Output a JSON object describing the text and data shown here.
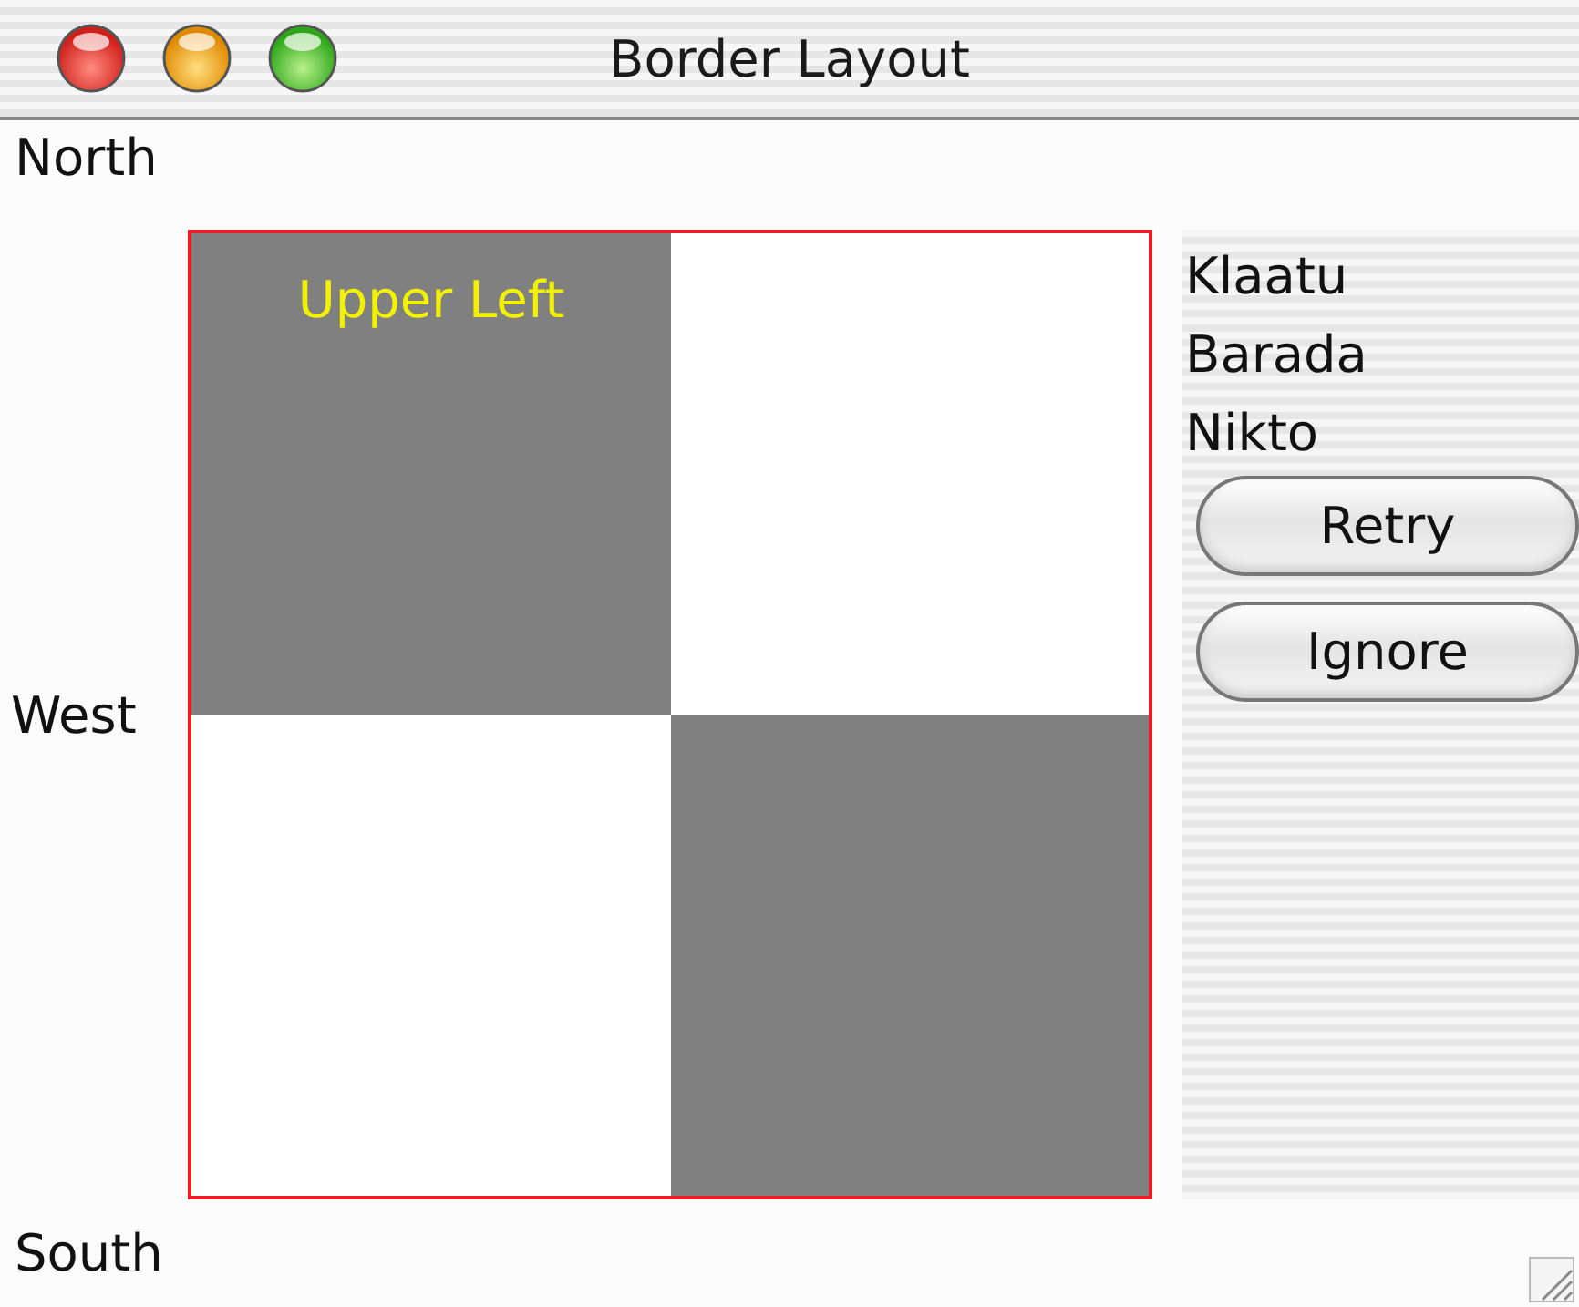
{
  "window": {
    "title": "Border Layout"
  },
  "north": {
    "label": "North"
  },
  "west": {
    "label": "West"
  },
  "center": {
    "cells": [
      {
        "label": "Upper Left",
        "color": "#808080"
      },
      {
        "color": "#ffffff"
      },
      {
        "color": "#ffffff"
      },
      {
        "color": "#808080"
      }
    ]
  },
  "east": {
    "labels": [
      "Klaatu",
      "Barada",
      "Nikto"
    ],
    "buttons": [
      "Retry",
      "Ignore"
    ]
  },
  "south": {
    "label": "South"
  }
}
